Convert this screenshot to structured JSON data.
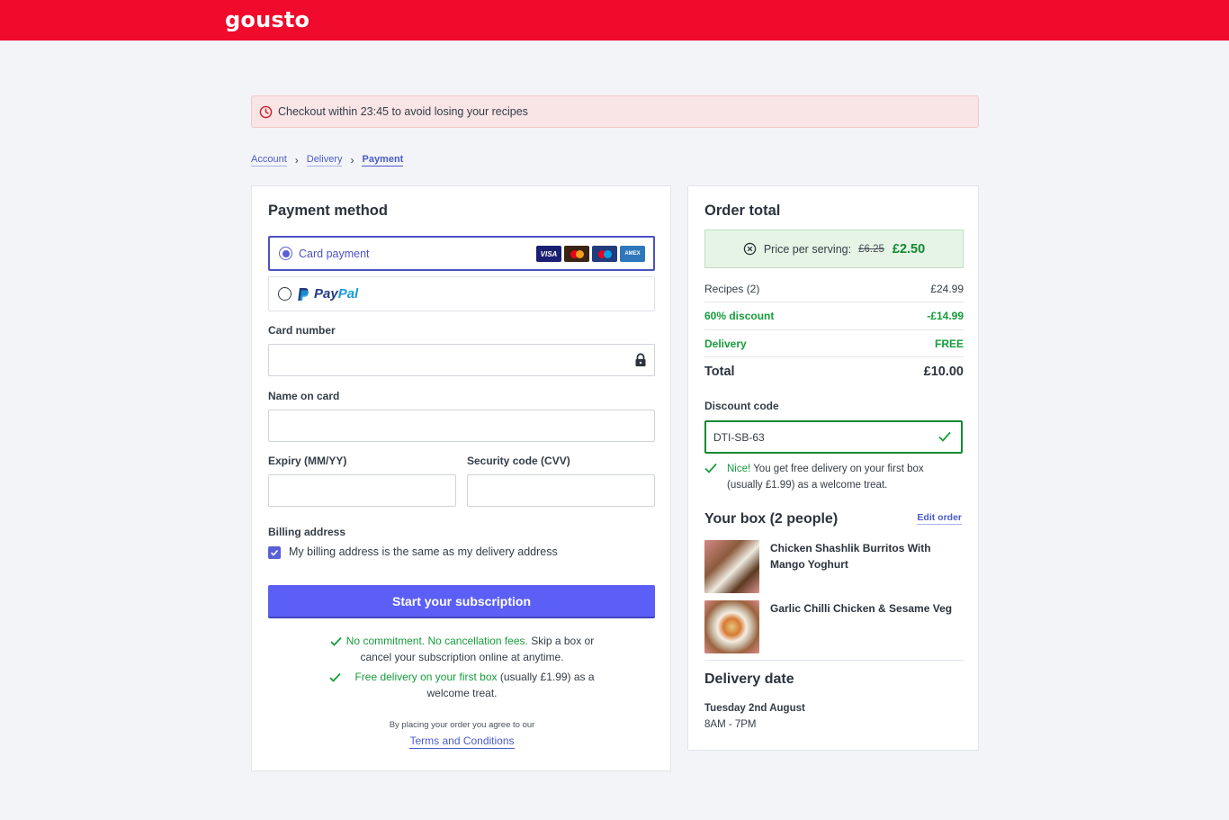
{
  "header": {
    "logo": "gousto",
    "brand_color": "#f00a2b"
  },
  "timer": {
    "text": "Checkout within 23:45 to avoid losing your recipes",
    "icon": "clock-icon"
  },
  "breadcrumb": {
    "items": [
      "Account",
      "Delivery",
      "Payment"
    ],
    "current": "Payment"
  },
  "payment": {
    "title": "Payment method",
    "card_option": "Card payment",
    "card_brands": [
      "VISA",
      "Mastercard",
      "Maestro",
      "AMEX"
    ],
    "paypal_pay": "Pay",
    "paypal_pal": "Pal",
    "card_number_label": "Card number",
    "card_number_value": "",
    "name_label": "Name on card",
    "name_value": "",
    "expiry_label": "Expiry (MM/YY)",
    "expiry_value": "",
    "cvv_label": "Security code (CVV)",
    "cvv_value": "",
    "billing_label": "Billing address",
    "billing_same": "My billing address is the same as my delivery address",
    "billing_checked": true,
    "cta": "Start your subscription",
    "perk1_green": "No commitment. No cancellation fees.",
    "perk1_rest_a": " Skip a box or",
    "perk1_rest_b": "cancel your subscription online at anytime.",
    "perk2_green": "Free delivery on your first box",
    "perk2_rest_a": " (usually £1.99) as a",
    "perk2_rest_b": "welcome treat.",
    "terms_prefix": "By placing your order you agree to our",
    "terms_link": "Terms and Conditions",
    "accent_color": "#5b5ff5"
  },
  "order": {
    "title": "Order total",
    "price_label": "Price per serving:",
    "price_old": "£6.25",
    "price_new": "£2.50",
    "recipes_label": "Recipes (2)",
    "recipes_value": "£24.99",
    "discount_label": "60% discount",
    "discount_value": "-£14.99",
    "delivery_label": "Delivery",
    "delivery_value": "FREE",
    "total_label": "Total",
    "total_value": "£10.00",
    "discount_code_label": "Discount code",
    "discount_code_value": "DTI-SB-63",
    "discount_msg_green": "Nice!",
    "discount_msg_a": " You get free delivery on your first box",
    "discount_msg_b": "(usually £1.99) as a welcome treat.",
    "box_title": "Your box (2 people)",
    "edit_order": "Edit order",
    "recipes": [
      {
        "name_a": "Chicken Shashlik Burritos With",
        "name_b": "Mango Yoghurt"
      },
      {
        "name_a": "Garlic Chilli Chicken & Sesame Veg",
        "name_b": ""
      }
    ],
    "delivery_title": "Delivery date",
    "delivery_day": "Tuesday 2nd August",
    "delivery_time": "8AM - 7PM",
    "success_color": "#159d3b"
  }
}
